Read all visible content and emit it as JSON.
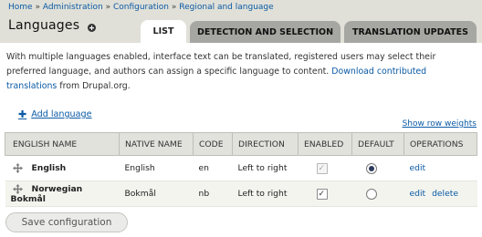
{
  "breadcrumb": {
    "items": [
      "Home",
      "Administration",
      "Configuration",
      "Regional and language"
    ],
    "separator": "»"
  },
  "page": {
    "title": "Languages"
  },
  "tabs": [
    {
      "label": "LIST",
      "active": true
    },
    {
      "label": "DETECTION AND SELECTION",
      "active": false
    },
    {
      "label": "TRANSLATION UPDATES",
      "active": false
    }
  ],
  "description": {
    "text": "With multiple languages enabled, interface text can be translated, registered users may select their preferred language, and authors can assign a specific language to content.",
    "link": "Download contributed translations",
    "suffix": "from Drupal.org."
  },
  "actions": {
    "add_language": "Add language",
    "show_row_weights": "Show row weights"
  },
  "table": {
    "headers": [
      "ENGLISH NAME",
      "NATIVE NAME",
      "CODE",
      "DIRECTION",
      "ENABLED",
      "DEFAULT",
      "OPERATIONS"
    ],
    "rows": [
      {
        "english_name": "English",
        "native_name": "English",
        "code": "en",
        "direction": "Left to right",
        "enabled": true,
        "enabled_disabled": true,
        "default": true,
        "operations": [
          "edit"
        ]
      },
      {
        "english_name": "Norwegian Bokmål",
        "native_name": "Bokmål",
        "code": "nb",
        "direction": "Left to right",
        "enabled": true,
        "enabled_disabled": false,
        "default": false,
        "operations": [
          "edit",
          "delete"
        ]
      }
    ]
  },
  "footer": {
    "save_button": "Save configuration"
  },
  "colors": {
    "link": "#0b5aa5",
    "header_bg": "#e0e0d8",
    "tab_inactive": "#a6a7a2",
    "table_header": "#e1e2dc"
  }
}
